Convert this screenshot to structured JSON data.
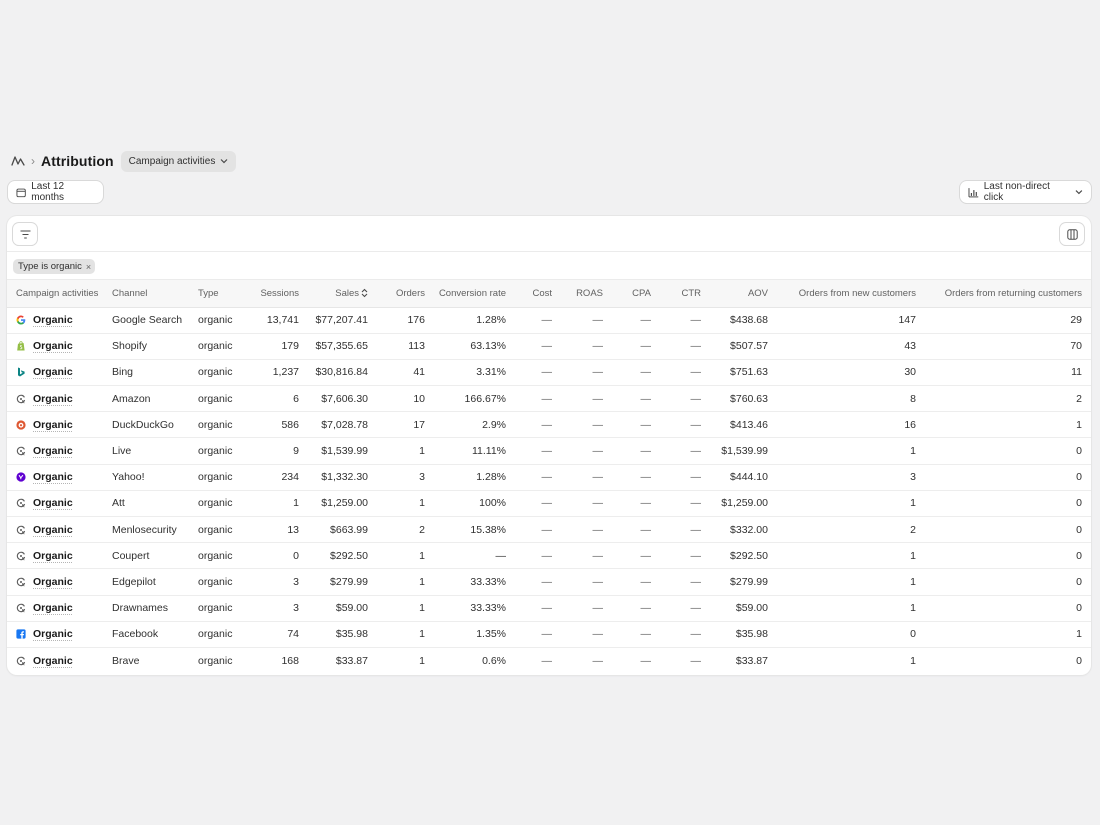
{
  "header": {
    "title": "Attribution",
    "view_label": "Campaign activities"
  },
  "toolbar": {
    "date_label": "Last 12 months",
    "model_label": "Last non-direct click"
  },
  "filter": {
    "chip_label": "Type is organic",
    "chip_remove": "×"
  },
  "table": {
    "columns": [
      "Campaign activities",
      "Channel",
      "Type",
      "Sessions",
      "Sales",
      "Orders",
      "Conversion rate",
      "Cost",
      "ROAS",
      "CPA",
      "CTR",
      "AOV",
      "Orders from new customers",
      "Orders from returning customers"
    ],
    "rows": [
      {
        "campaign": "Organic",
        "channel": "Google Search",
        "icon": "google-icon",
        "type": "organic",
        "sessions": "13,741",
        "sales": "$77,207.41",
        "orders": "176",
        "conversion": "1.28%",
        "cost": "—",
        "roas": "—",
        "cpa": "—",
        "ctr": "—",
        "aov": "$438.68",
        "new": "147",
        "returning": "29"
      },
      {
        "campaign": "Organic",
        "channel": "Shopify",
        "icon": "shopify-icon",
        "type": "organic",
        "sessions": "179",
        "sales": "$57,355.65",
        "orders": "113",
        "conversion": "63.13%",
        "cost": "—",
        "roas": "—",
        "cpa": "—",
        "ctr": "—",
        "aov": "$507.57",
        "new": "43",
        "returning": "70"
      },
      {
        "campaign": "Organic",
        "channel": "Bing",
        "icon": "bing-icon",
        "type": "organic",
        "sessions": "1,237",
        "sales": "$30,816.84",
        "orders": "41",
        "conversion": "3.31%",
        "cost": "—",
        "roas": "—",
        "cpa": "—",
        "ctr": "—",
        "aov": "$751.63",
        "new": "30",
        "returning": "11"
      },
      {
        "campaign": "Organic",
        "channel": "Amazon",
        "icon": "generic-channel-icon",
        "type": "organic",
        "sessions": "6",
        "sales": "$7,606.30",
        "orders": "10",
        "conversion": "166.67%",
        "cost": "—",
        "roas": "—",
        "cpa": "—",
        "ctr": "—",
        "aov": "$760.63",
        "new": "8",
        "returning": "2"
      },
      {
        "campaign": "Organic",
        "channel": "DuckDuckGo",
        "icon": "duckduckgo-icon",
        "type": "organic",
        "sessions": "586",
        "sales": "$7,028.78",
        "orders": "17",
        "conversion": "2.9%",
        "cost": "—",
        "roas": "—",
        "cpa": "—",
        "ctr": "—",
        "aov": "$413.46",
        "new": "16",
        "returning": "1"
      },
      {
        "campaign": "Organic",
        "channel": "Live",
        "icon": "generic-channel-icon",
        "type": "organic",
        "sessions": "9",
        "sales": "$1,539.99",
        "orders": "1",
        "conversion": "11.11%",
        "cost": "—",
        "roas": "—",
        "cpa": "—",
        "ctr": "—",
        "aov": "$1,539.99",
        "new": "1",
        "returning": "0"
      },
      {
        "campaign": "Organic",
        "channel": "Yahoo!",
        "icon": "yahoo-icon",
        "type": "organic",
        "sessions": "234",
        "sales": "$1,332.30",
        "orders": "3",
        "conversion": "1.28%",
        "cost": "—",
        "roas": "—",
        "cpa": "—",
        "ctr": "—",
        "aov": "$444.10",
        "new": "3",
        "returning": "0"
      },
      {
        "campaign": "Organic",
        "channel": "Att",
        "icon": "generic-channel-icon",
        "type": "organic",
        "sessions": "1",
        "sales": "$1,259.00",
        "orders": "1",
        "conversion": "100%",
        "cost": "—",
        "roas": "—",
        "cpa": "—",
        "ctr": "—",
        "aov": "$1,259.00",
        "new": "1",
        "returning": "0"
      },
      {
        "campaign": "Organic",
        "channel": "Menlosecurity",
        "icon": "generic-channel-icon",
        "type": "organic",
        "sessions": "13",
        "sales": "$663.99",
        "orders": "2",
        "conversion": "15.38%",
        "cost": "—",
        "roas": "—",
        "cpa": "—",
        "ctr": "—",
        "aov": "$332.00",
        "new": "2",
        "returning": "0"
      },
      {
        "campaign": "Organic",
        "channel": "Coupert",
        "icon": "generic-channel-icon",
        "type": "organic",
        "sessions": "0",
        "sales": "$292.50",
        "orders": "1",
        "conversion": "—",
        "cost": "—",
        "roas": "—",
        "cpa": "—",
        "ctr": "—",
        "aov": "$292.50",
        "new": "1",
        "returning": "0"
      },
      {
        "campaign": "Organic",
        "channel": "Edgepilot",
        "icon": "generic-channel-icon",
        "type": "organic",
        "sessions": "3",
        "sales": "$279.99",
        "orders": "1",
        "conversion": "33.33%",
        "cost": "—",
        "roas": "—",
        "cpa": "—",
        "ctr": "—",
        "aov": "$279.99",
        "new": "1",
        "returning": "0"
      },
      {
        "campaign": "Organic",
        "channel": "Drawnames",
        "icon": "generic-channel-icon",
        "type": "organic",
        "sessions": "3",
        "sales": "$59.00",
        "orders": "1",
        "conversion": "33.33%",
        "cost": "—",
        "roas": "—",
        "cpa": "—",
        "ctr": "—",
        "aov": "$59.00",
        "new": "1",
        "returning": "0"
      },
      {
        "campaign": "Organic",
        "channel": "Facebook",
        "icon": "facebook-icon",
        "type": "organic",
        "sessions": "74",
        "sales": "$35.98",
        "orders": "1",
        "conversion": "1.35%",
        "cost": "—",
        "roas": "—",
        "cpa": "—",
        "ctr": "—",
        "aov": "$35.98",
        "new": "0",
        "returning": "1"
      },
      {
        "campaign": "Organic",
        "channel": "Brave",
        "icon": "generic-channel-icon",
        "type": "organic",
        "sessions": "168",
        "sales": "$33.87",
        "orders": "1",
        "conversion": "0.6%",
        "cost": "—",
        "roas": "—",
        "cpa": "—",
        "ctr": "—",
        "aov": "$33.87",
        "new": "1",
        "returning": "0"
      }
    ]
  }
}
